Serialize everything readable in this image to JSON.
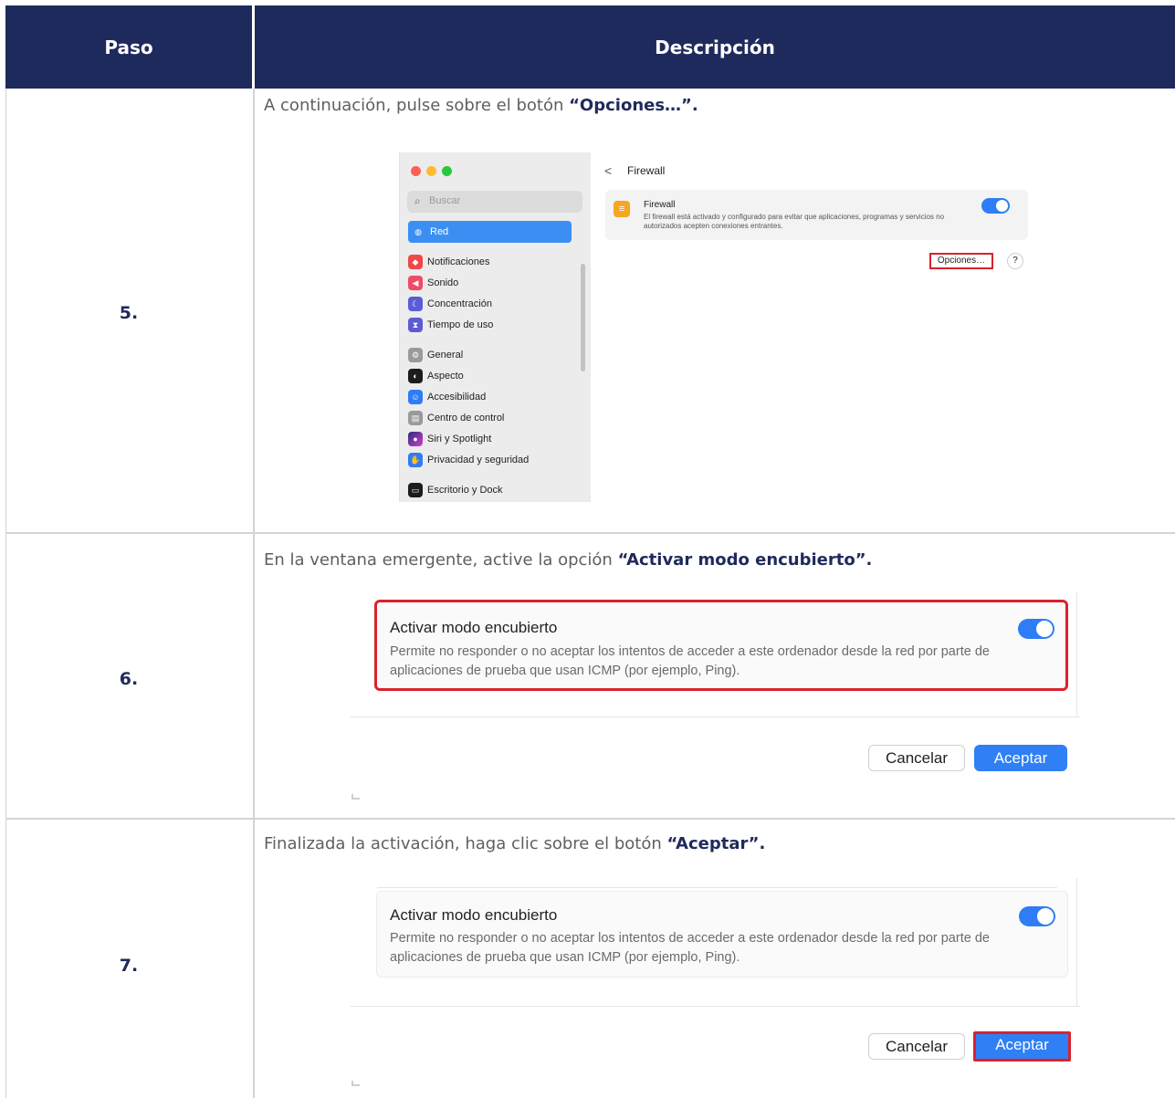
{
  "header": {
    "paso": "Paso",
    "descripcion": "Descripción"
  },
  "steps": [
    {
      "number": "5.",
      "text": "A continuación, pulse sobre el botón ",
      "bold": "“Opciones…”."
    },
    {
      "number": "6.",
      "text": "En la ventana emergente, active la opción ",
      "bold": "“Activar modo encubierto”."
    },
    {
      "number": "7.",
      "text": "Finalizada la activación, haga clic sobre el botón ",
      "bold": "“Aceptar”."
    }
  ],
  "mac": {
    "search_placeholder": "Buscar",
    "selected_item": "Red",
    "sidebar_items": [
      "Notificaciones",
      "Sonido",
      "Concentración",
      "Tiempo de uso",
      "General",
      "Aspecto",
      "Accesibilidad",
      "Centro de control",
      "Siri y Spotlight",
      "Privacidad y seguridad",
      "Escritorio y Dock"
    ],
    "back": "<",
    "title": "Firewall",
    "fw_name": "Firewall",
    "fw_desc": "El firewall está activado y configurado para evitar que aplicaciones, programas y servicios no autorizados acepten conexiones entrantes.",
    "options_button": "Opciones…",
    "help_button": "?"
  },
  "dialog": {
    "option_title": "Activar modo encubierto",
    "option_desc": "Permite no responder o no aceptar los intentos de acceder a este ordenador desde la red por parte de aplicaciones de prueba que usan ICMP (por ejemplo, Ping).",
    "cancel": "Cancelar",
    "accept": "Aceptar",
    "toggle_on": true
  },
  "colors": {
    "header_bg": "#1f2a5c",
    "highlight": "#d9222d",
    "accent": "#2e7df6"
  }
}
